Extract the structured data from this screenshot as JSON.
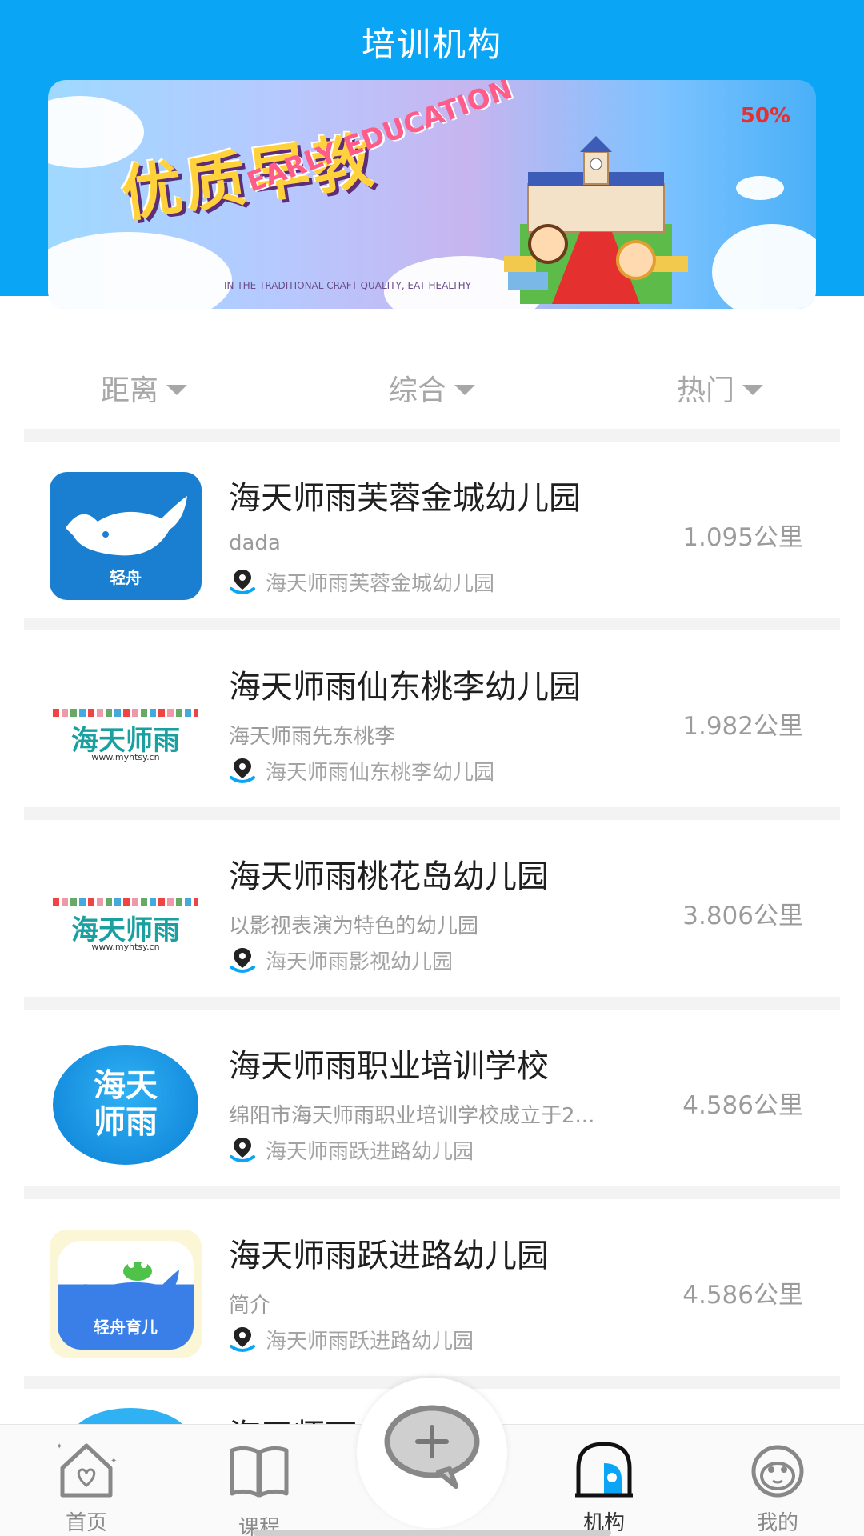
{
  "header": {
    "title": "培训机构"
  },
  "banner": {
    "headline": "优质早教",
    "subtitle": "EARLY EDUCATION",
    "small_text": "IN THE TRADITIONAL CRAFT QUALITY, EAT HEALTHY",
    "badge": "50%"
  },
  "filters": [
    {
      "label": "距离"
    },
    {
      "label": "综合"
    },
    {
      "label": "热门"
    }
  ],
  "list": [
    {
      "title": "海天师雨芙蓉金城幼儿园",
      "desc": "dada",
      "address": "海天师雨芙蓉金城幼儿园",
      "distance": "1.095公里",
      "logo": "whale",
      "logo_text": "轻舟"
    },
    {
      "title": "海天师雨仙东桃李幼儿园",
      "desc": "海天师雨先东桃李",
      "address": "海天师雨仙东桃李幼儿园",
      "distance": "1.982公里",
      "logo": "text",
      "logo_text": "海天师雨",
      "logo_url": "www.myhtsy.cn"
    },
    {
      "title": "海天师雨桃花岛幼儿园",
      "desc": "以影视表演为特色的幼儿园",
      "address": "海天师雨影视幼儿园",
      "distance": "3.806公里",
      "logo": "text",
      "logo_text": "海天师雨",
      "logo_url": "www.myhtsy.cn"
    },
    {
      "title": "海天师雨职业培训学校",
      "desc": "绵阳市海天师雨职业培训学校成立于2...",
      "address": "海天师雨跃进路幼儿园",
      "distance": "4.586公里",
      "logo": "circle",
      "logo_text_top": "海天",
      "logo_text_bottom": "师雨"
    },
    {
      "title": "海天师雨跃进路幼儿园",
      "desc": "简介",
      "address": "海天师雨跃进路幼儿园",
      "distance": "4.586公里",
      "logo": "yellow",
      "logo_text": "轻舟育儿"
    },
    {
      "title": "海天师雨",
      "desc": "",
      "address": "",
      "distance": "",
      "logo": "partial"
    }
  ],
  "bottom_nav": {
    "items": [
      {
        "label": "首页",
        "icon": "home-heart-icon"
      },
      {
        "label": "课程",
        "icon": "book-icon"
      },
      {
        "label": "机构",
        "icon": "institution-icon",
        "active": true
      },
      {
        "label": "我的",
        "icon": "monkey-icon"
      }
    ],
    "fab_icon": "chat-plus-icon"
  },
  "colors": {
    "accent": "#0aa6f5",
    "muted_text": "#9b9b9b",
    "separator": "#f3f3f3"
  }
}
